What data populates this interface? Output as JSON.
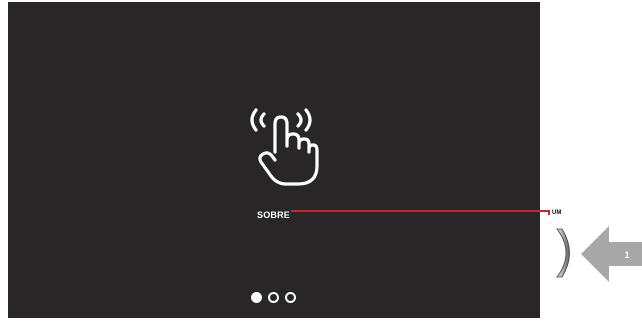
{
  "screen": {
    "labels": {
      "sobre": "SOBRE"
    },
    "icon": "touch-hand-icon",
    "pagination": {
      "pages": 3,
      "active_index": 0
    }
  },
  "annotations": {
    "side_label": "UM",
    "callout_number": "1",
    "leader_color": "#c0282d",
    "callout_color": "#a7a7a7"
  },
  "colors": {
    "screen_bg": "#2a2627",
    "foreground": "#ffffff"
  }
}
